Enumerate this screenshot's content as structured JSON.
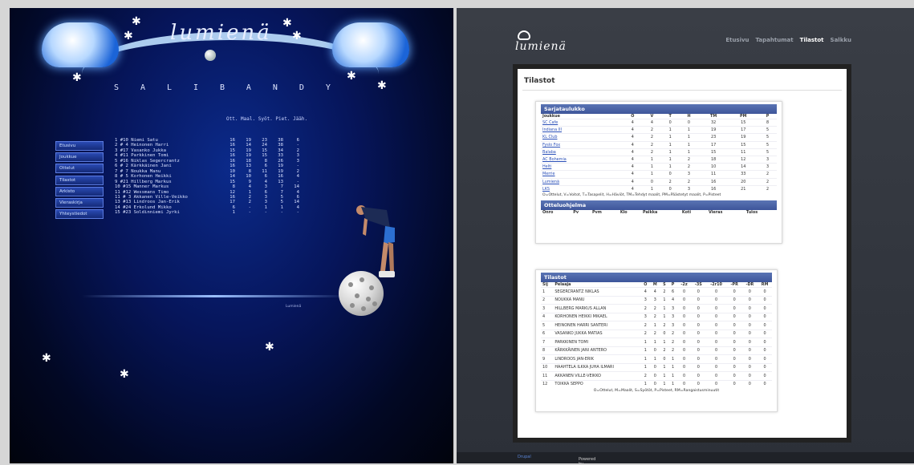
{
  "left": {
    "logo": "lumienä",
    "sport_letters": [
      "S",
      "A",
      "L",
      "I",
      "B",
      "A",
      "N",
      "D",
      "Y"
    ],
    "table_header": "Ott. Maal. Syöt. Piet. Jääh.",
    "nav": [
      "Etusivu",
      "Joukkue",
      "Ottelut",
      "Tilastot",
      "Arkisto",
      "Vieraskirja",
      "Yhteystiedot"
    ],
    "rows": [
      {
        "name": "1 #10 Niemi Satu",
        "v": [
          "16",
          "19",
          "23",
          "38",
          "6"
        ]
      },
      {
        "name": "2 # 4 Heinonen Harri",
        "v": [
          "16",
          "14",
          "24",
          "38",
          "-"
        ]
      },
      {
        "name": "3 #17 Vasanko Jukka",
        "v": [
          "15",
          "19",
          "15",
          "34",
          "2"
        ]
      },
      {
        "name": "4 #11 Parkkinen Tomi",
        "v": [
          "16",
          "19",
          "15",
          "33",
          "3"
        ]
      },
      {
        "name": "5 #16 Niklas Segercrantz",
        "v": [
          "16",
          "18",
          "8",
          "26",
          "3"
        ]
      },
      {
        "name": "6 # 2 Kärkkäinen Jani",
        "v": [
          "16",
          "13",
          "6",
          "19",
          "-"
        ]
      },
      {
        "name": "7 # 7 Noukka Manu",
        "v": [
          "10",
          "8",
          "11",
          "19",
          "2"
        ]
      },
      {
        "name": "8 # 5 Korhonen Heikki",
        "v": [
          "14",
          "10",
          "6",
          "16",
          "4"
        ]
      },
      {
        "name": "9 #21 Hillberg Markus",
        "v": [
          "15",
          "9",
          "4",
          "13",
          "-"
        ]
      },
      {
        "name": "10 #15 Manner Markus",
        "v": [
          "8",
          "4",
          "3",
          "7",
          "14"
        ]
      },
      {
        "name": "11 #12 Wessmans Timo",
        "v": [
          "12",
          "1",
          "6",
          "7",
          "4"
        ]
      },
      {
        "name": "11 # 3 Akkanen Ville-Veikko",
        "v": [
          "16",
          "2",
          "3",
          "5",
          "6"
        ]
      },
      {
        "name": "13 #13 Lindroos Jan-Erik",
        "v": [
          "17",
          "2",
          "3",
          "5",
          "14"
        ]
      },
      {
        "name": "14 #24 Erkolund Mikko",
        "v": [
          "6",
          "-",
          "1",
          "1",
          "4"
        ]
      },
      {
        "name": "15 #23 Soldinniemi Jyrki",
        "v": [
          "1",
          "-",
          "-",
          "-",
          "-"
        ]
      }
    ],
    "footer_small": "Lumienä"
  },
  "right": {
    "logo": "lumienä",
    "nav": [
      {
        "label": "Etusivu",
        "active": false
      },
      {
        "label": "Tapahtumat",
        "active": false
      },
      {
        "label": "Tilastot",
        "active": true
      },
      {
        "label": "Salkku",
        "active": false
      }
    ],
    "page_title": "Tilastot",
    "standings": {
      "title": "Sarjataulukko",
      "headers": [
        "Joukkue",
        "O",
        "V",
        "T",
        "H",
        "TM",
        "PM",
        "P"
      ],
      "rows": [
        [
          "SC Cafe",
          "4",
          "4",
          "0",
          "0",
          "32",
          "15",
          "8"
        ],
        [
          "Indiana III",
          "4",
          "2",
          "1",
          "1",
          "19",
          "17",
          "5"
        ],
        [
          "KL Club",
          "4",
          "2",
          "1",
          "1",
          "23",
          "19",
          "5"
        ],
        [
          "Fyslo Fox",
          "4",
          "2",
          "1",
          "1",
          "17",
          "15",
          "5"
        ],
        [
          "Balaba",
          "4",
          "2",
          "1",
          "1",
          "15",
          "11",
          "5"
        ],
        [
          "AC Bohemia",
          "4",
          "1",
          "1",
          "2",
          "18",
          "12",
          "3"
        ],
        [
          "Helti",
          "4",
          "1",
          "1",
          "2",
          "10",
          "14",
          "3"
        ],
        [
          "Merrie",
          "4",
          "1",
          "0",
          "3",
          "11",
          "33",
          "2"
        ],
        [
          "Lumienä",
          "4",
          "0",
          "2",
          "2",
          "16",
          "20",
          "2"
        ],
        [
          "LKS",
          "4",
          "1",
          "0",
          "3",
          "16",
          "21",
          "2"
        ]
      ],
      "legend": "O=Ottelut, V=Voitot, T=Tasapelit, H=Häviöt, TM=Tehdyt maalit, PM=Päästetyt maalit, P=Pisteet"
    },
    "schedule": {
      "title": "Otteluohjelma",
      "headers": [
        "Onro",
        "Pv",
        "Pvm",
        "Klo",
        "Paikka",
        "Koti",
        "Vieras",
        "Tulos"
      ]
    },
    "stats": {
      "title": "Tilastot",
      "headers": [
        "Sij",
        "Pelaaja",
        "O",
        "M",
        "S",
        "P",
        "-2z",
        "-3S",
        "-2r10",
        "-PR",
        "-DR",
        "RM"
      ],
      "rows": [
        [
          "1",
          "SEGERCRANTZ NIKLAS",
          "4",
          "4",
          "2",
          "6",
          "0",
          "0",
          "0",
          "0",
          "0",
          "0"
        ],
        [
          "2",
          "NOUKKA MANU",
          "3",
          "3",
          "1",
          "4",
          "0",
          "0",
          "0",
          "0",
          "0",
          "0"
        ],
        [
          "3",
          "HILLBERG MARKUS ALLAN",
          "2",
          "2",
          "1",
          "3",
          "0",
          "0",
          "0",
          "0",
          "0",
          "0"
        ],
        [
          "4",
          "KORHONEN HEIKKI MIKAEL",
          "3",
          "2",
          "1",
          "3",
          "0",
          "0",
          "0",
          "0",
          "0",
          "0"
        ],
        [
          "5",
          "HEINONEN HARRI SANTERI",
          "2",
          "1",
          "2",
          "3",
          "0",
          "0",
          "0",
          "0",
          "0",
          "0"
        ],
        [
          "6",
          "VASANKO JUKKA MATIAS",
          "2",
          "2",
          "0",
          "2",
          "0",
          "0",
          "0",
          "0",
          "0",
          "0"
        ],
        [
          "7",
          "PARKKINEN TOMI",
          "1",
          "1",
          "1",
          "2",
          "0",
          "0",
          "0",
          "0",
          "0",
          "0"
        ],
        [
          "8",
          "KÄRKKÄINEN JANI ANTERO",
          "1",
          "0",
          "2",
          "2",
          "0",
          "0",
          "0",
          "0",
          "0",
          "0"
        ],
        [
          "9",
          "LINDROOS JAN-ERIK",
          "1",
          "1",
          "0",
          "1",
          "0",
          "0",
          "0",
          "0",
          "0",
          "0"
        ],
        [
          "10",
          "HAAHTELA ILKKA JUHA ILMARI",
          "1",
          "0",
          "1",
          "1",
          "0",
          "0",
          "0",
          "0",
          "0",
          "0"
        ],
        [
          "11",
          "AKKANEN VILLE-VEIKKO",
          "2",
          "0",
          "1",
          "1",
          "0",
          "0",
          "0",
          "0",
          "0",
          "0"
        ],
        [
          "12",
          "TOIKKA SEPPO",
          "1",
          "0",
          "1",
          "1",
          "0",
          "0",
          "0",
          "0",
          "0",
          "0"
        ]
      ],
      "legend": "O=Ottelut, M=Maalit, S=Syötöt, P=Pisteet, RM=Rangaistusminuutit"
    },
    "footer_prefix": "Powered by ",
    "footer_link": "Drupal"
  }
}
